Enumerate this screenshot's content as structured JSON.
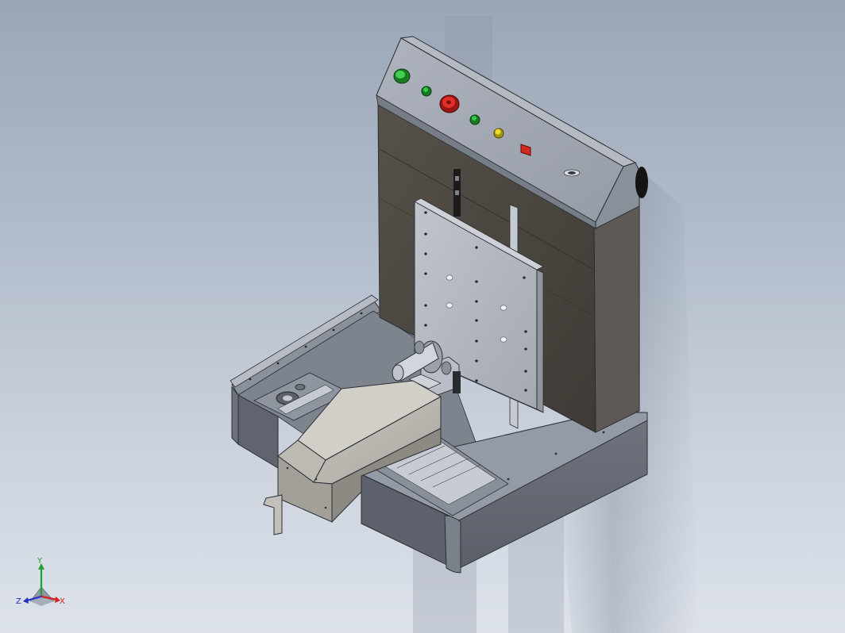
{
  "viewport": {
    "background_top": "#9aa6b6",
    "background_bottom": "#dde2ea"
  },
  "model": {
    "description_hidden": "",
    "control_panel": {
      "buttons": [
        {
          "name": "green-mushroom-button",
          "color": "#1f9a2a"
        },
        {
          "name": "green-indicator-light",
          "color": "#1e8f28"
        },
        {
          "name": "red-emergency-stop",
          "color": "#c8201c"
        },
        {
          "name": "green-indicator-light-2",
          "color": "#1e8f28"
        },
        {
          "name": "yellow-indicator-light",
          "color": "#d9c21a"
        },
        {
          "name": "red-square-switch",
          "color": "#d42a22"
        }
      ]
    },
    "colors": {
      "body_dark": "#4a4640",
      "panel_steel": "#8e949e",
      "panel_light": "#a9afb9",
      "plate": "#b4b9c2",
      "tray_dark": "#5a5f69",
      "carriage": "#b9b6ae"
    }
  },
  "triad": {
    "x_label": "X",
    "y_label": "Y",
    "z_label": "Z",
    "x_color": "#d22020",
    "y_color": "#20a030",
    "z_color": "#2030c8"
  }
}
